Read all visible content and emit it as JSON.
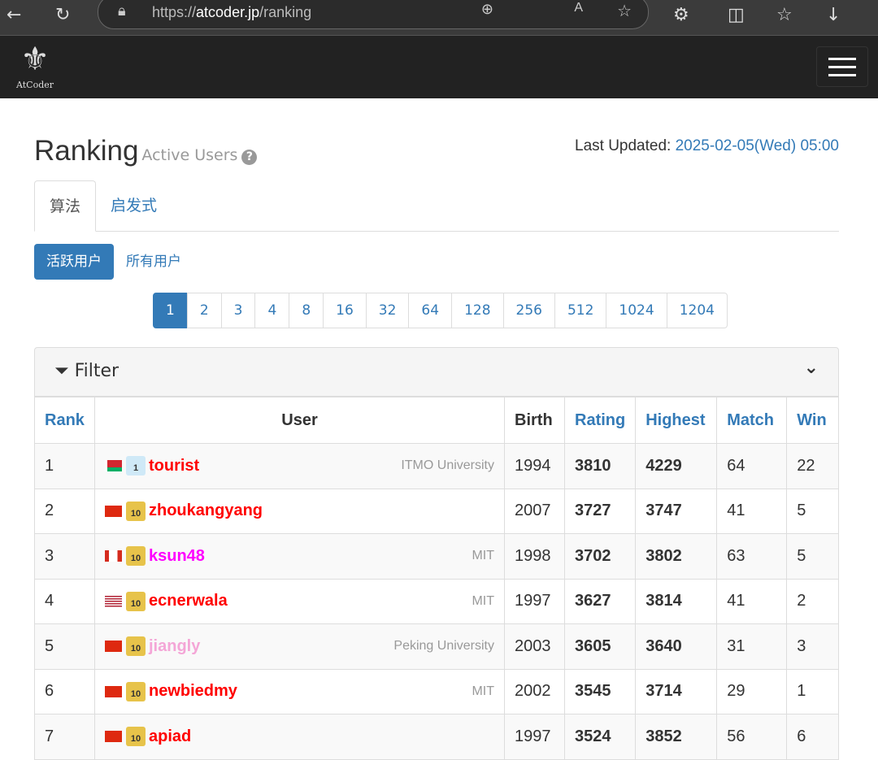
{
  "browser": {
    "url_prefix": "https://",
    "url_host": "atcoder.jp",
    "url_path": "/ranking"
  },
  "navbar": {
    "logo_text": "AtCoder"
  },
  "header": {
    "title": "Ranking",
    "subtitle": "Active Users",
    "help": "?",
    "updated_label": "Last Updated:",
    "updated_value": "2025-02-05(Wed) 05:00"
  },
  "tabs": [
    {
      "label": "算法"
    },
    {
      "label": "启发式"
    }
  ],
  "subtabs": [
    {
      "label": "活跃用户"
    },
    {
      "label": "所有用户"
    }
  ],
  "pagination": [
    "1",
    "2",
    "3",
    "4",
    "8",
    "16",
    "32",
    "64",
    "128",
    "256",
    "512",
    "1024",
    "1204"
  ],
  "filter": {
    "label": "Filter"
  },
  "table": {
    "headers": {
      "rank": "Rank",
      "user": "User",
      "birth": "Birth",
      "rating": "Rating",
      "highest": "Highest",
      "match": "Match",
      "win": "Win"
    },
    "rows": [
      {
        "rank": "1",
        "flag": "BY",
        "badge": "1",
        "user": "tourist",
        "color": "#ff0000",
        "aff": "ITMO University",
        "birth": "1994",
        "rating": "3810",
        "highest": "4229",
        "match": "64",
        "win": "22"
      },
      {
        "rank": "2",
        "flag": "CN",
        "badge": "10",
        "user": "zhoukangyang",
        "color": "#ff0000",
        "aff": "",
        "birth": "2007",
        "rating": "3727",
        "highest": "3747",
        "match": "41",
        "win": "5"
      },
      {
        "rank": "3",
        "flag": "CA",
        "badge": "10",
        "user": "ksun48",
        "color": "#ff00ff",
        "aff": "MIT",
        "birth": "1998",
        "rating": "3702",
        "highest": "3802",
        "match": "63",
        "win": "5"
      },
      {
        "rank": "4",
        "flag": "US",
        "badge": "10",
        "user": "ecnerwala",
        "color": "#ff0000",
        "aff": "MIT",
        "birth": "1997",
        "rating": "3627",
        "highest": "3814",
        "match": "41",
        "win": "2"
      },
      {
        "rank": "5",
        "flag": "CN",
        "badge": "10",
        "user": "jiangly",
        "color": "#f4a6d7",
        "aff": "Peking University",
        "birth": "2003",
        "rating": "3605",
        "highest": "3640",
        "match": "31",
        "win": "3"
      },
      {
        "rank": "6",
        "flag": "CN",
        "badge": "10",
        "user": "newbiedmy",
        "color": "#ff0000",
        "aff": "MIT",
        "birth": "2002",
        "rating": "3545",
        "highest": "3714",
        "match": "29",
        "win": "1"
      },
      {
        "rank": "7",
        "flag": "CN",
        "badge": "10",
        "user": "apiad",
        "color": "#ff0000",
        "aff": "",
        "birth": "1997",
        "rating": "3524",
        "highest": "3852",
        "match": "56",
        "win": "6"
      }
    ]
  }
}
